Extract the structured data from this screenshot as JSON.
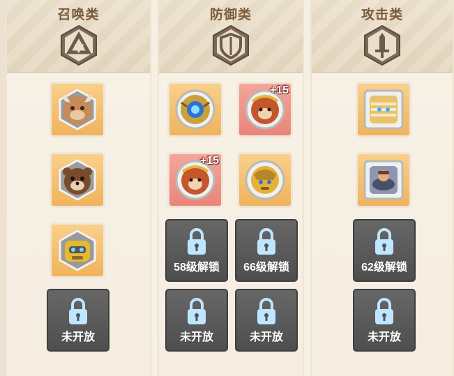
{
  "categories": [
    {
      "title": "召唤类",
      "emblem_icon": "triangle-symbol-icon",
      "slots": [
        {
          "status": "hero",
          "frame": "hex",
          "tint": "gold",
          "icon": "bull-warrior-hero-icon"
        },
        {
          "status": "hero",
          "frame": "hex",
          "tint": "gold",
          "icon": "bear-hero-icon"
        },
        {
          "status": "hero",
          "frame": "hex",
          "tint": "gold",
          "icon": "mech-bear-hero-icon"
        },
        {
          "status": "locked",
          "label": "未开放"
        }
      ]
    },
    {
      "title": "防御类",
      "emblem_icon": "shield-icon",
      "slots": [
        {
          "status": "hero",
          "frame": "round",
          "tint": "gold",
          "icon": "blue-orb-guardian-hero-icon"
        },
        {
          "status": "hero",
          "frame": "round",
          "tint": "red",
          "icon": "monkey-king-hero-icon",
          "badge": "+15"
        },
        {
          "status": "hero",
          "frame": "round",
          "tint": "red",
          "icon": "monkey-king-hero-icon",
          "badge": "+15"
        },
        {
          "status": "hero",
          "frame": "round",
          "tint": "gold",
          "icon": "golden-armor-hero-icon"
        },
        {
          "status": "locked",
          "label": "58级解锁"
        },
        {
          "status": "locked",
          "label": "66级解锁"
        },
        {
          "status": "locked",
          "label": "未开放"
        },
        {
          "status": "locked",
          "label": "未开放"
        }
      ]
    },
    {
      "title": "攻击类",
      "emblem_icon": "sword-icon",
      "slots": [
        {
          "status": "hero",
          "frame": "square",
          "tint": "gold",
          "icon": "mummy-hero-icon"
        },
        {
          "status": "hero",
          "frame": "square",
          "tint": "gold",
          "icon": "mech-rider-hero-icon"
        },
        {
          "status": "locked",
          "label": "62级解锁"
        },
        {
          "status": "locked",
          "label": "未开放"
        }
      ]
    }
  ],
  "colors": {
    "gold_tint": "#f0b35c",
    "red_tint": "#e9857a",
    "lock_tile": "#575757",
    "lock_icon": "#bfe6ff",
    "title": "#7a5b3a"
  }
}
